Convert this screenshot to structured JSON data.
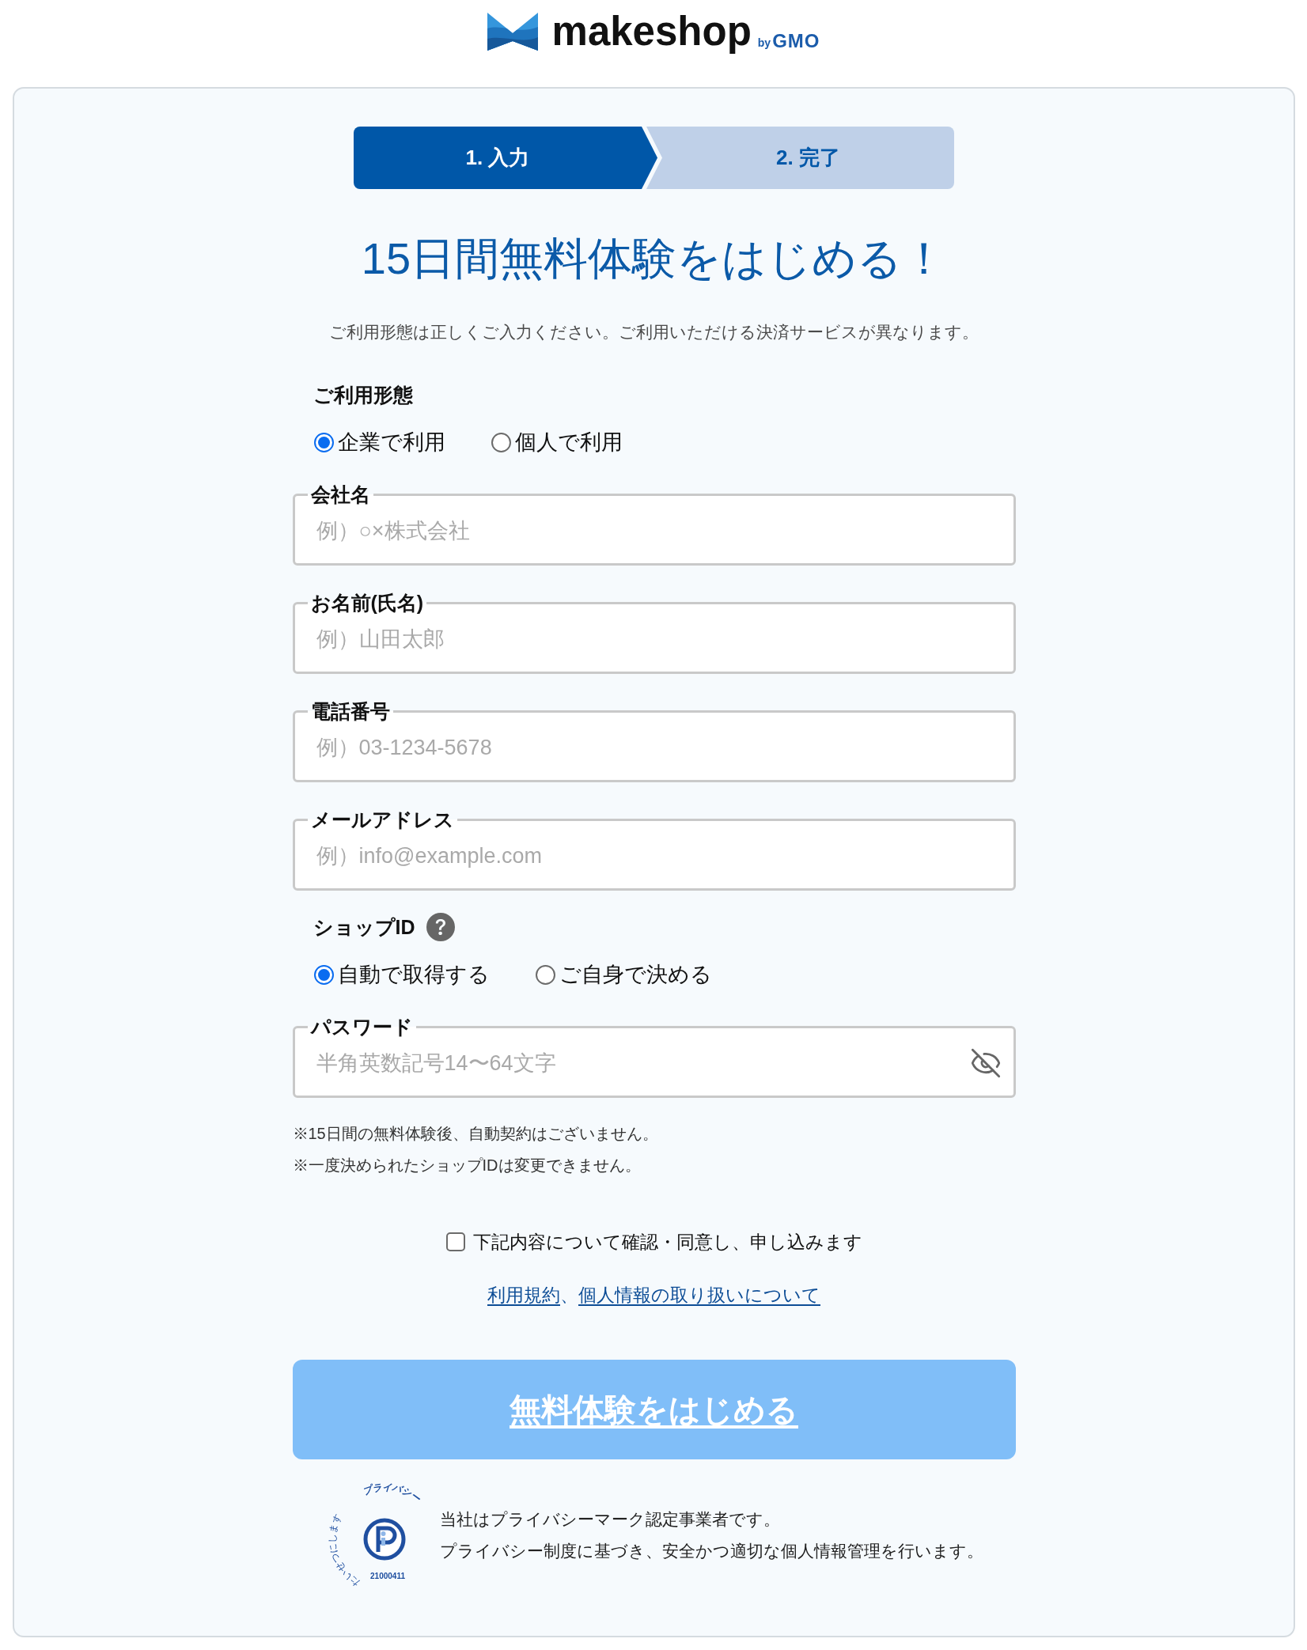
{
  "logo": {
    "wordmark": "makeshop",
    "by": "by",
    "company": "GMO"
  },
  "steps": [
    {
      "label": "1. 入力",
      "selected": true
    },
    {
      "label": "2. 完了",
      "selected": false
    }
  ],
  "title": "15日間無料体験をはじめる！",
  "subtitle": "ご利用形態は正しくご入力ください。ご利用いただける決済サービスが異なります。",
  "form": [
    {
      "kind": "radio_group",
      "label": "ご利用形態",
      "options": [
        {
          "label": "企業で利用",
          "selected": true
        },
        {
          "label": "個人で利用",
          "selected": false
        }
      ]
    },
    {
      "kind": "text_field",
      "label": "会社名",
      "placeholder": "例）○×株式会社"
    },
    {
      "kind": "text_field",
      "label": "お名前(氏名)",
      "placeholder": "例）山田太郎"
    },
    {
      "kind": "text_field",
      "label": "電話番号",
      "placeholder": "例）03-1234-5678"
    },
    {
      "kind": "text_field",
      "label": "メールアドレス",
      "placeholder": "例）info@example.com"
    },
    {
      "kind": "radio_group",
      "label": "ショップID",
      "help": true,
      "options": [
        {
          "label": "自動で取得する",
          "selected": true
        },
        {
          "label": "ご自身で決める",
          "selected": false
        }
      ]
    },
    {
      "kind": "password_field",
      "label": "パスワード",
      "placeholder": "半角英数記号14〜64文字",
      "masked": true
    }
  ],
  "notes": [
    "※15日間の無料体験後、自動契約はございません。",
    "※一度決められたショップIDは変更できません。"
  ],
  "agreement": {
    "label": "下記内容について確認・同意し、申し込みます",
    "checked": false
  },
  "links": {
    "items": [
      "利用規約",
      "個人情報の取り扱いについて"
    ],
    "separator": "、"
  },
  "submit": {
    "label": "無料体験をはじめる",
    "disabled": true
  },
  "privacy": {
    "mark_caption": [
      "たいせつにします",
      "プライバシー"
    ],
    "mark_number": "21000411",
    "lines": [
      "当社はプライバシーマーク認定事業者です。",
      "プライバシー制度に基づき、安全かつ適切な個人情報管理を行います。"
    ]
  }
}
